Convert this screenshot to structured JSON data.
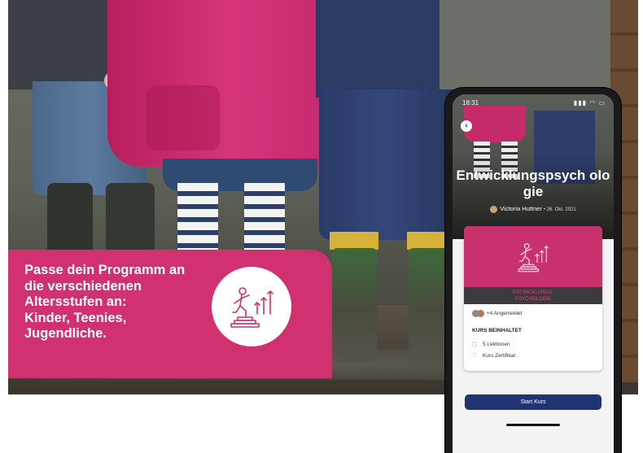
{
  "card": {
    "lines": [
      "Passe dein Programm an",
      "die verschiedenen",
      "Altersstufen an:",
      "Kinder, Teenies,",
      "Jugendliche."
    ],
    "icon": "person-climbing-stairs-growth-icon",
    "background": "#d1316f"
  },
  "phone": {
    "status_time": "18:31",
    "status_icons": "▮▮▮ ◠ ▭",
    "back_icon": "‹",
    "hero_title": "Entwicklungspsych ologie",
    "author": "Victoria Huttner",
    "date": "• 26. Okt. 2021",
    "course": {
      "band_line1": "ENTWICKLUNGS-",
      "band_line2": "PSYCHOLOGIE",
      "enrolled": "+4 Angemeldet",
      "section_title": "KURS BEINHALTET",
      "items": [
        {
          "icon": "screen-icon",
          "glyph": "▢",
          "label": "5 Lektionen"
        },
        {
          "icon": "certificate-icon",
          "glyph": "♡",
          "label": "Kurs Zertifikat"
        }
      ]
    },
    "cta_label": "Start Kurs",
    "accent": "#1f3470"
  }
}
